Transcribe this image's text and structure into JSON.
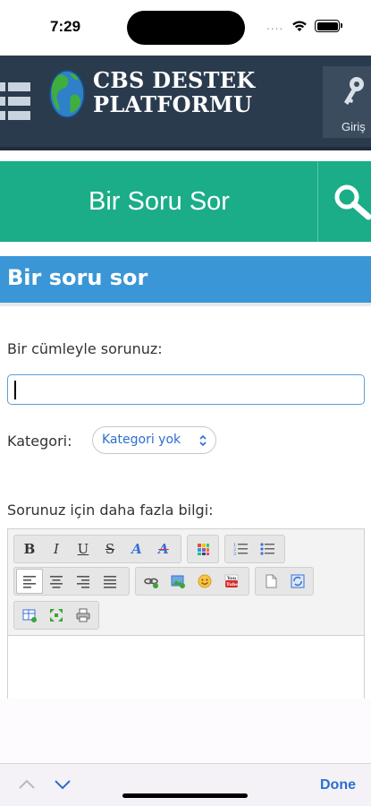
{
  "status_bar": {
    "time": "7:29",
    "dots": "...."
  },
  "header": {
    "brand_line1": "CBS DESTEK",
    "brand_line2": "PLATFORMU",
    "login_label": "Giriş",
    "colors": {
      "background": "#2a3b4e",
      "login_bg": "#3b4c5f"
    }
  },
  "ask_bar": {
    "label": "Bir Soru Sor",
    "color": "#1aad87"
  },
  "section": {
    "title": "Bir soru sor",
    "color": "#3a96d7"
  },
  "form": {
    "question_label": "Bir cümleyle sorunuz:",
    "question_value": "",
    "category_label": "Kategori:",
    "category_value": "Kategori yok",
    "more_info_label": "Sorunuz için daha fazla bilgi:"
  },
  "editor_toolbar": {
    "bold": "B",
    "italic": "I",
    "underline": "U",
    "strike": "S",
    "font_color": "A",
    "remove_format": "A",
    "icons": [
      "bold-icon",
      "italic-icon",
      "underline-icon",
      "strikethrough-icon",
      "font-color-icon",
      "remove-format-icon",
      "color-palette-icon",
      "ordered-list-icon",
      "unordered-list-icon",
      "align-left-icon",
      "align-center-icon",
      "align-right-icon",
      "align-justify-icon",
      "link-icon",
      "image-icon",
      "emoji-icon",
      "youtube-icon",
      "document-icon",
      "refresh-icon",
      "insert-table-icon",
      "fullscreen-icon",
      "print-icon"
    ]
  },
  "accessory_bar": {
    "done_label": "Done"
  }
}
